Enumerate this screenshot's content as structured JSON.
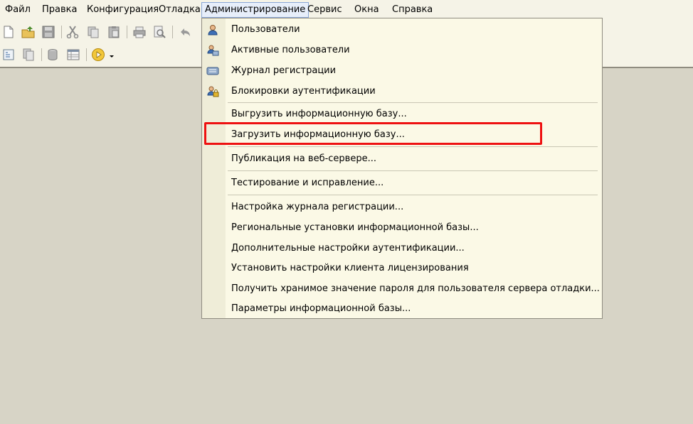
{
  "menubar": {
    "items": [
      {
        "label": "Файл",
        "name": "menu-file"
      },
      {
        "label": "Правка",
        "name": "menu-edit"
      },
      {
        "label": "Конфигурация",
        "name": "menu-configuration"
      },
      {
        "label": "Отладка",
        "name": "menu-debug"
      },
      {
        "label": "Администрирование",
        "name": "menu-administration"
      },
      {
        "label": "Сервис",
        "name": "menu-service"
      },
      {
        "label": "Окна",
        "name": "menu-windows"
      },
      {
        "label": "Справка",
        "name": "menu-help"
      }
    ]
  },
  "toolbar": {
    "row1_icons": [
      "new-document-icon",
      "open-folder-icon",
      "save-icon",
      "cut-icon",
      "copy-icon",
      "paste-icon",
      "print-icon",
      "print-preview-icon",
      "undo-icon"
    ],
    "row2_icons": [
      "structure-icon",
      "compare-icon",
      "database-icon",
      "table-icon",
      "start-debug-icon"
    ]
  },
  "admin_menu": {
    "items": [
      {
        "label": "Пользователи",
        "icon": "user-icon"
      },
      {
        "label": "Активные пользователи",
        "icon": "active-users-icon"
      },
      {
        "label": "Журнал регистрации",
        "icon": "event-log-icon"
      },
      {
        "label": "Блокировки аутентификации",
        "icon": "auth-lock-icon"
      },
      {
        "label": "Выгрузить информационную базу..."
      },
      {
        "label": "Загрузить информационную базу..."
      },
      {
        "label": "Публикация на веб-сервере..."
      },
      {
        "label": "Тестирование и исправление..."
      },
      {
        "label": "Настройка журнала регистрации..."
      },
      {
        "label": "Региональные установки информационной базы..."
      },
      {
        "label": "Дополнительные настройки аутентификации..."
      },
      {
        "label": "Установить настройки клиента лицензирования"
      },
      {
        "label": "Получить хранимое значение пароля для пользователя сервера отладки..."
      },
      {
        "label": "Параметры информационной базы..."
      }
    ]
  },
  "colors": {
    "highlight": "#ee1111",
    "menu_bg": "#fbf9e6",
    "workspace": "#d7d4c6"
  }
}
